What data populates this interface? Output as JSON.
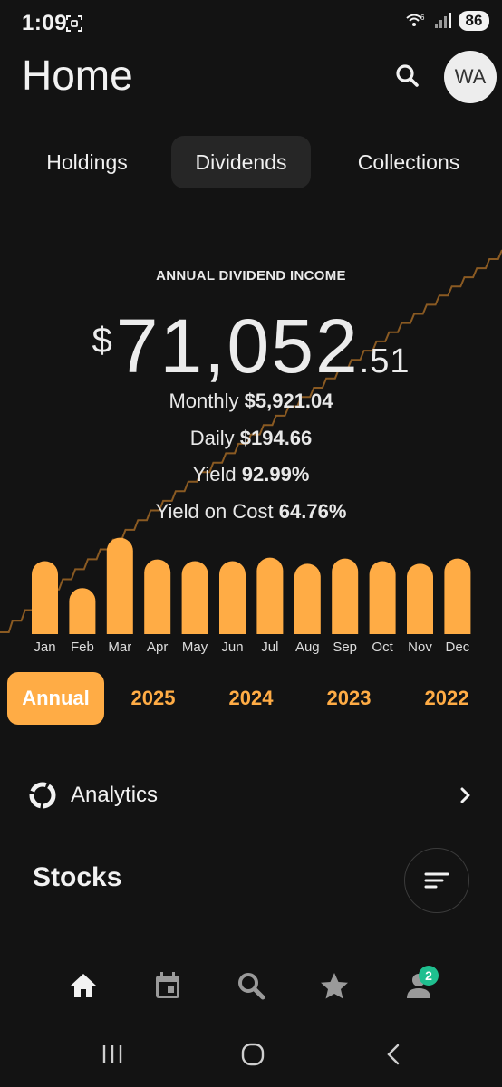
{
  "status": {
    "time": "1:09",
    "network": "6",
    "battery": "86"
  },
  "header": {
    "title": "Home",
    "avatar_initials": "WA"
  },
  "tabs": [
    {
      "label": "Holdings"
    },
    {
      "label": "Dividends",
      "selected": true
    },
    {
      "label": "Collections"
    }
  ],
  "summary": {
    "heading": "ANNUAL DIVIDEND INCOME",
    "currency": "$",
    "whole": "71,052",
    "cents": ".51",
    "monthly_label": "Monthly",
    "monthly_value": "$5,921.04",
    "daily_label": "Daily",
    "daily_value": "$194.66",
    "yield_label": "Yield",
    "yield_value": "92.99%",
    "yoc_label": "Yield on Cost",
    "yoc_value": "64.76%"
  },
  "chart_data": {
    "type": "bar",
    "categories": [
      "Jan",
      "Feb",
      "Mar",
      "Apr",
      "May",
      "Jun",
      "Jul",
      "Aug",
      "Sep",
      "Oct",
      "Nov",
      "Dec"
    ],
    "values": [
      84,
      53,
      111,
      86,
      84,
      84,
      88,
      81,
      87,
      84,
      81,
      87
    ],
    "ylim": [
      0,
      120
    ],
    "bar_color": "#ffac45",
    "line_color": "#8a5a22"
  },
  "year_filters": [
    {
      "label": "Annual",
      "selected": true
    },
    {
      "label": "2025"
    },
    {
      "label": "2024"
    },
    {
      "label": "2023"
    },
    {
      "label": "2022"
    }
  ],
  "analytics": {
    "label": "Analytics"
  },
  "stocks": {
    "title": "Stocks"
  },
  "bottom_nav": [
    {
      "icon": "home-icon"
    },
    {
      "icon": "calendar-icon"
    },
    {
      "icon": "search-icon"
    },
    {
      "icon": "star-icon"
    },
    {
      "icon": "profile-icon",
      "badge": "2"
    }
  ],
  "colors": {
    "accent": "#ffac45",
    "background": "#131313",
    "badge": "#1fbf8f"
  }
}
